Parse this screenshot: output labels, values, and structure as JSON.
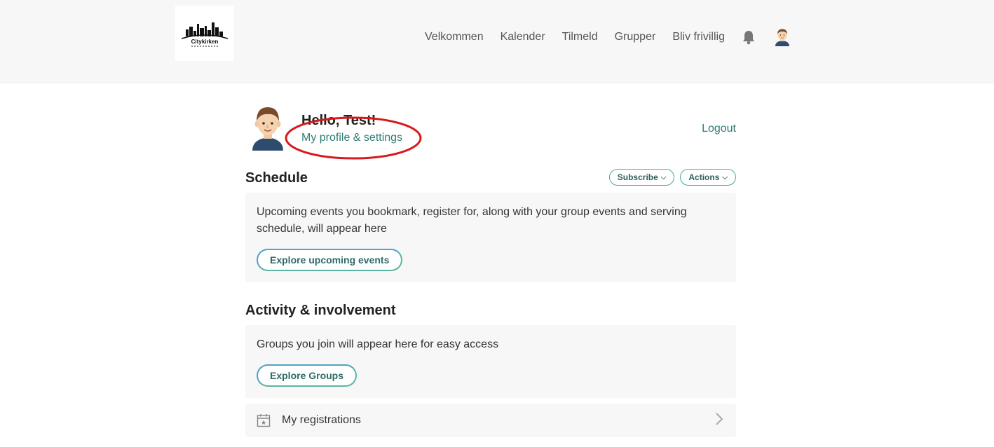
{
  "header": {
    "logo_text": "Citykirken",
    "nav": [
      {
        "label": "Velkommen"
      },
      {
        "label": "Kalender"
      },
      {
        "label": "Tilmeld"
      },
      {
        "label": "Grupper"
      },
      {
        "label": "Bliv frivillig"
      }
    ],
    "icons": [
      "bell-icon",
      "user-avatar"
    ]
  },
  "greeting": {
    "hello": "Hello, Test!",
    "profile_link": "My profile & settings",
    "logout": "Logout"
  },
  "schedule": {
    "title": "Schedule",
    "subscribe_label": "Subscribe",
    "actions_label": "Actions",
    "empty_text": "Upcoming events you bookmark, register for, along with your group events and serving schedule, will appear here",
    "explore_label": "Explore upcoming events"
  },
  "activity": {
    "title": "Activity & involvement",
    "empty_text": "Groups you join will appear here for easy access",
    "explore_label": "Explore Groups"
  },
  "registrations": {
    "label": "My registrations"
  },
  "colors": {
    "accent": "#2f7d74",
    "highlight_ring": "#d9191c",
    "card_bg": "#f7f7f7"
  }
}
